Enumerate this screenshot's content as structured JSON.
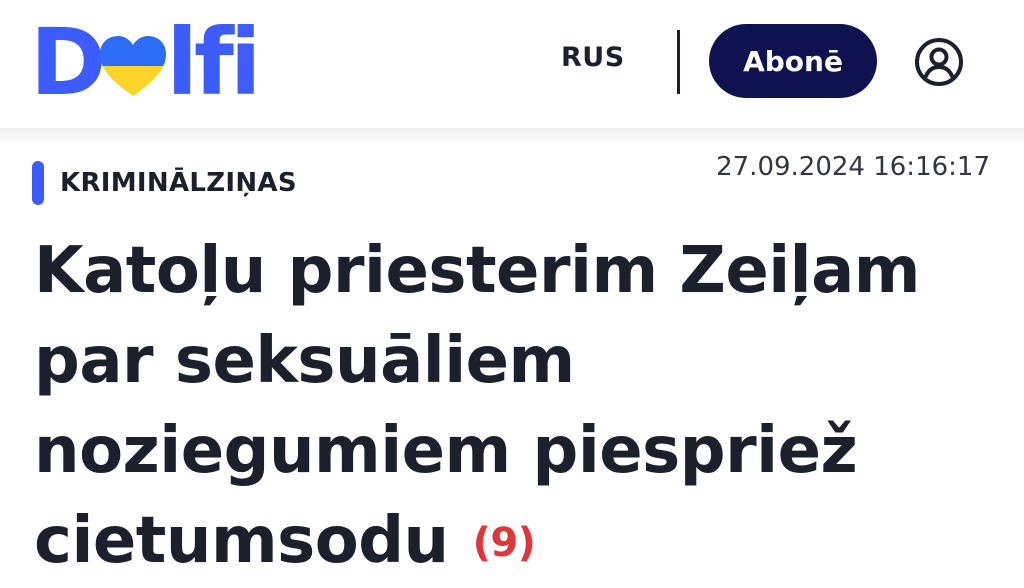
{
  "header": {
    "logo": {
      "letter_d": "D",
      "letters_rest": "lfi",
      "text_color": "#3d5cff",
      "heart_top_color": "#2d6df6",
      "heart_bottom_color": "#ffd42a"
    },
    "language_link": "RUS",
    "subscribe_label": "Abonē",
    "subscribe_bg": "#0f1250",
    "divider_color": "#1c1f2c",
    "account_icon": "user-circle-icon"
  },
  "article": {
    "category": "KRIMINĀLZIŅAS",
    "category_accent": "#3d5cff",
    "timestamp": "27.09.2024 16:16:17",
    "headline": "Katoļu priesterim Zeiļam par seksuāliem noziegumiem piespriež cietumsodu",
    "comment_count": "(9)",
    "comment_color": "#e3343a"
  },
  "colors": {
    "text_primary": "#1c1f2c",
    "text_secondary": "#333640"
  }
}
